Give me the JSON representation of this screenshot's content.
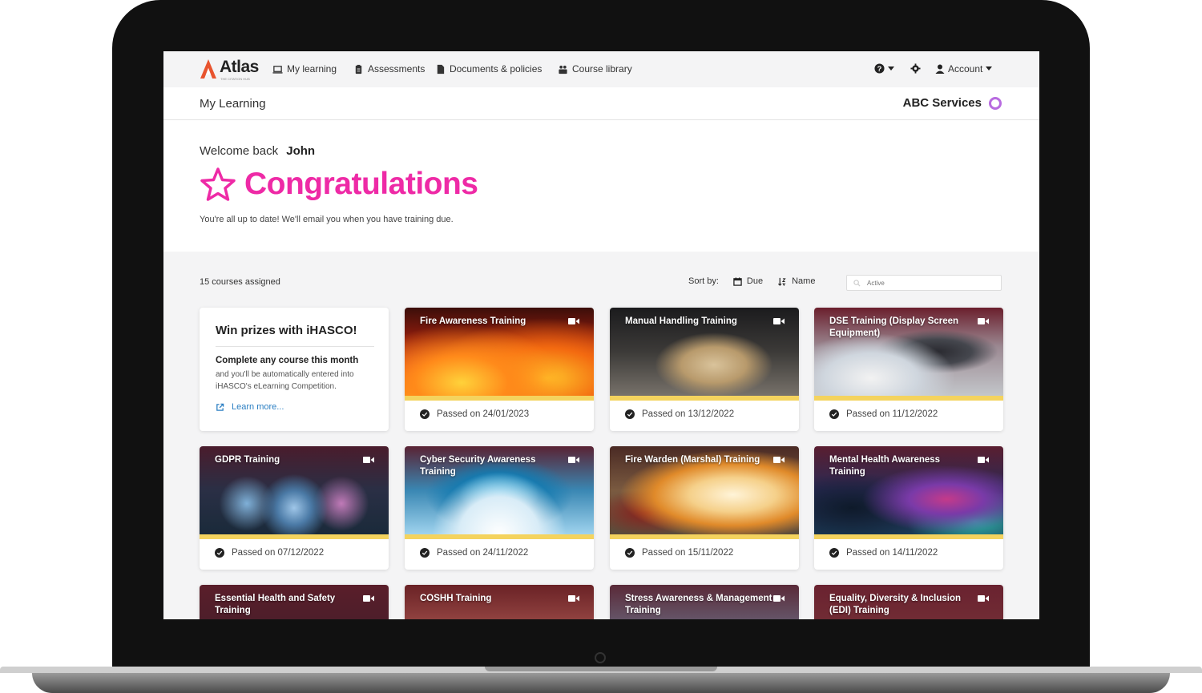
{
  "nav": {
    "logo": "Atlas",
    "logo_sub": "THE CITATION HUB",
    "items": [
      {
        "label": "My learning",
        "icon": "laptop-icon"
      },
      {
        "label": "Assessments",
        "icon": "clipboard-icon"
      },
      {
        "label": "Documents & policies",
        "icon": "document-icon"
      },
      {
        "label": "Course library",
        "icon": "users-icon"
      }
    ],
    "help_icon": "help-icon",
    "settings_icon": "gear-icon",
    "account_label": "Account"
  },
  "subheader": {
    "title": "My Learning",
    "org": "ABC Services"
  },
  "welcome": {
    "greeting": "Welcome back",
    "name": "John",
    "headline": "Congratulations",
    "message": "You're all up to date! We'll email you when you have training due."
  },
  "courses": {
    "count_label": "15 courses assigned",
    "sort_label": "Sort by:",
    "sort_due": "Due",
    "sort_name": "Name",
    "search_placeholder": "Active"
  },
  "promo": {
    "title": "Win prizes with iHASCO!",
    "bold": "Complete any course this month",
    "text": "and you'll be automatically entered into iHASCO's eLearning Competition.",
    "link": "Learn more..."
  },
  "cards": [
    {
      "title": "Fire Awareness Training",
      "status": "Passed on 24/01/2023"
    },
    {
      "title": "Manual Handling Training",
      "status": "Passed on 13/12/2022"
    },
    {
      "title": "DSE Training (Display Screen Equipment)",
      "status": "Passed on 11/12/2022"
    },
    {
      "title": "GDPR Training",
      "status": "Passed on 07/12/2022"
    },
    {
      "title": "Cyber Security Awareness Training",
      "status": "Passed on 24/11/2022"
    },
    {
      "title": "Fire Warden (Marshal) Training",
      "status": "Passed on 15/11/2022"
    },
    {
      "title": "Mental Health Awareness Training",
      "status": "Passed on 14/11/2022"
    },
    {
      "title": "Essential Health and Safety Training",
      "status": ""
    },
    {
      "title": "COSHH Training",
      "status": ""
    },
    {
      "title": "Stress Awareness & Management Training",
      "status": ""
    },
    {
      "title": "Equality, Diversity & Inclusion (EDI) Training",
      "status": ""
    }
  ],
  "colors": {
    "accent": "#ee2aa6",
    "link": "#2b7fc3",
    "strip": "#f4d35e",
    "logo": "#e8542f"
  }
}
